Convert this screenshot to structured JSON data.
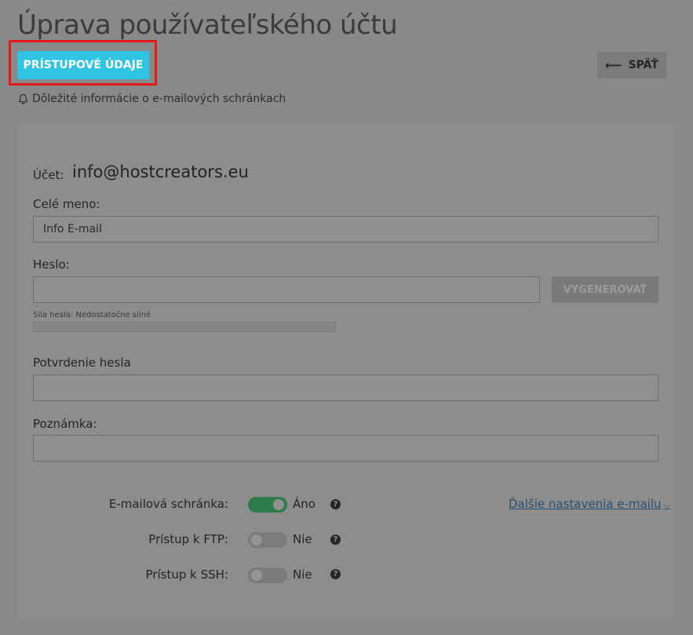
{
  "page": {
    "title": "Úprava používateľského účtu",
    "access_button": "PRÍSTUPOVÉ ÚDAJE",
    "back_button": "SPÄŤ",
    "info_link": "Dôležité informácie o e-mailových schránkach"
  },
  "form": {
    "account_label": "Účet:",
    "account_value": "info@hostcreators.eu",
    "full_name_label": "Celé meno:",
    "full_name_value": "Info E-mail",
    "password_label": "Heslo:",
    "password_value": "",
    "generate_button": "VYGENEROVAŤ",
    "strength_text": "Sila hesla: Nedostatočne silné",
    "strength_level": 0,
    "confirm_label": "Potvrdenie hesla",
    "confirm_value": "",
    "note_label": "Poznámka:",
    "note_value": ""
  },
  "toggles": [
    {
      "label": "E-mailová schránka:",
      "state": "Áno",
      "on": true
    },
    {
      "label": "Prístup k FTP:",
      "state": "Nie",
      "on": false
    },
    {
      "label": "Prístup k SSH:",
      "state": "Nie",
      "on": false
    }
  ],
  "more_settings_link": "Ďalšie nastavenia e-mailu",
  "colors": {
    "accent": "#2ec4e2",
    "highlight": "#e21a1a",
    "toggle_on": "#2d7c49"
  },
  "icons": {
    "bell": "bell-icon",
    "back_arrow": "arrow-left-icon",
    "help": "question-circle-icon",
    "chevron": "chevron-down-icon"
  }
}
